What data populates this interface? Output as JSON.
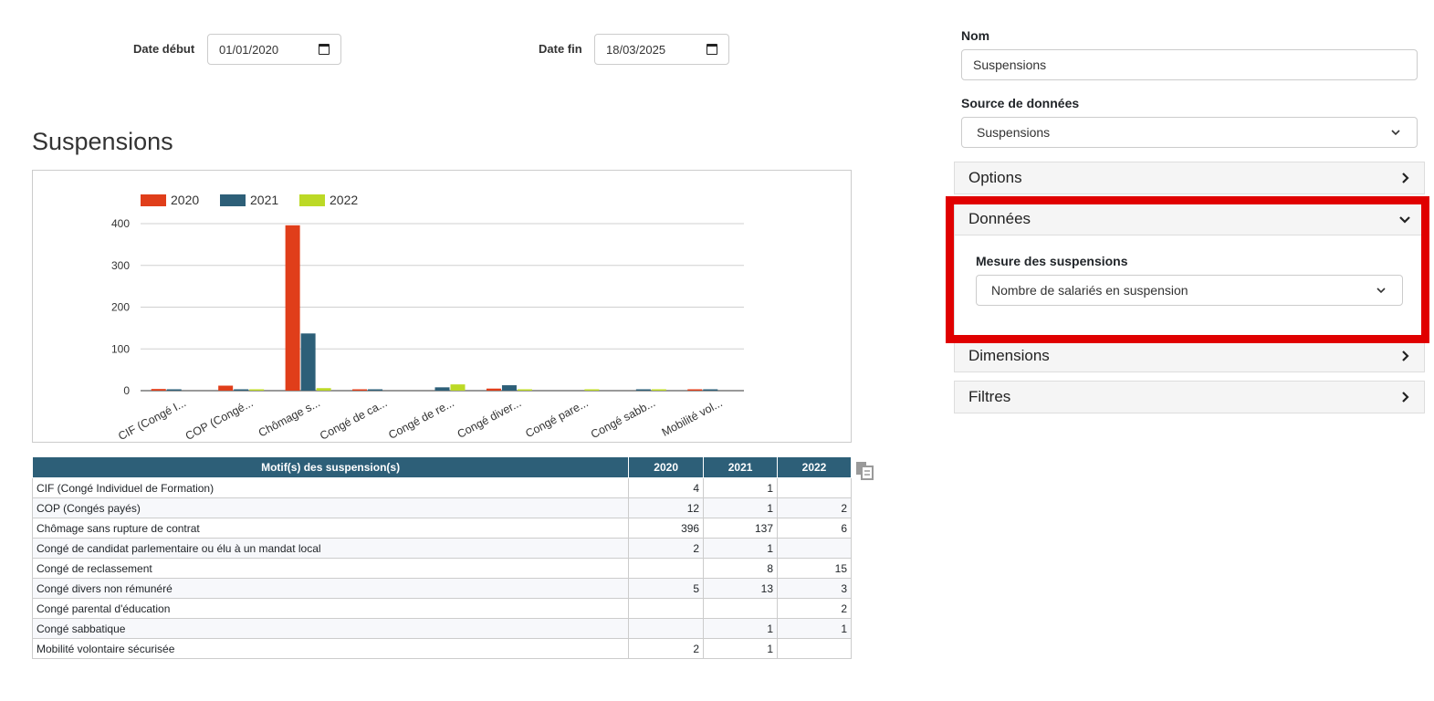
{
  "filters": {
    "start_label": "Date début",
    "start_value": "01/01/2020",
    "end_label": "Date fin",
    "end_value": "18/03/2025"
  },
  "report_title": "Suspensions",
  "chart_data": {
    "type": "bar",
    "categories": [
      "CIF (Congé I...",
      "COP (Congé...",
      "Chômage s...",
      "Congé de ca...",
      "Congé de re...",
      "Congé diver...",
      "Congé pare...",
      "Congé sabb...",
      "Mobilité vol..."
    ],
    "series": [
      {
        "name": "2020",
        "color": "#e03e1a",
        "values": [
          4,
          12,
          396,
          2,
          0,
          5,
          0,
          0,
          2
        ]
      },
      {
        "name": "2021",
        "color": "#2d5f78",
        "values": [
          1,
          1,
          137,
          1,
          8,
          13,
          0,
          1,
          1
        ]
      },
      {
        "name": "2022",
        "color": "#bcd926",
        "values": [
          0,
          2,
          6,
          0,
          15,
          3,
          2,
          1,
          0
        ]
      }
    ],
    "yticks": [
      0,
      100,
      200,
      300,
      400
    ],
    "ylim": [
      0,
      400
    ],
    "grid": true,
    "legend_position": "top-left"
  },
  "table": {
    "headers": [
      "Motif(s) des suspension(s)",
      "2020",
      "2021",
      "2022"
    ],
    "rows": [
      [
        "CIF (Congé Individuel de Formation)",
        "4",
        "1",
        ""
      ],
      [
        "COP (Congés payés)",
        "12",
        "1",
        "2"
      ],
      [
        "Chômage sans rupture de contrat",
        "396",
        "137",
        "6"
      ],
      [
        "Congé de candidat parlementaire ou élu à un mandat local",
        "2",
        "1",
        ""
      ],
      [
        "Congé de reclassement",
        "",
        "8",
        "15"
      ],
      [
        "Congé divers non rémunéré",
        "5",
        "13",
        "3"
      ],
      [
        "Congé parental d'éducation",
        "",
        "",
        "2"
      ],
      [
        "Congé sabbatique",
        "",
        "1",
        "1"
      ],
      [
        "Mobilité volontaire sécurisée",
        "2",
        "1",
        ""
      ]
    ]
  },
  "sidebar": {
    "name_label": "Nom",
    "name_value": "Suspensions",
    "source_label": "Source de données",
    "source_value": "Suspensions",
    "sections": {
      "options": "Options",
      "donnees": "Données",
      "dimensions": "Dimensions",
      "filtres": "Filtres"
    },
    "measure_label": "Mesure des suspensions",
    "measure_value": "Nombre de salariés en suspension"
  },
  "icons": {
    "copy": "copy-icon",
    "calendar": "calendar-icon",
    "chevron_right": "chevron-right-icon",
    "chevron_down": "chevron-down-icon"
  },
  "highlight_color": "#e00000"
}
